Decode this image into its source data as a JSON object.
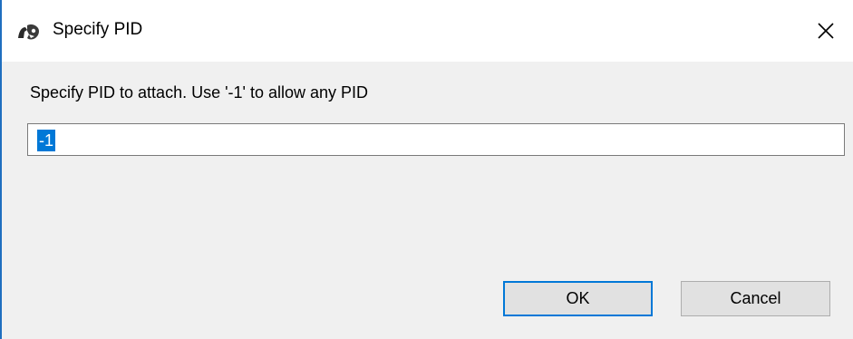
{
  "window": {
    "title": "Specify PID",
    "app_icon": "app-logo-icon",
    "close_icon": "close-icon"
  },
  "dialog": {
    "prompt": "Specify PID to attach. Use '-1' to allow any PID",
    "pid_value": "-1",
    "ok_label": "OK",
    "cancel_label": "Cancel"
  },
  "colors": {
    "selection": "#0078d7",
    "window_border": "#1f6fbf",
    "dialog_bg": "#f0f0f0",
    "button_bg": "#e1e1e1"
  }
}
